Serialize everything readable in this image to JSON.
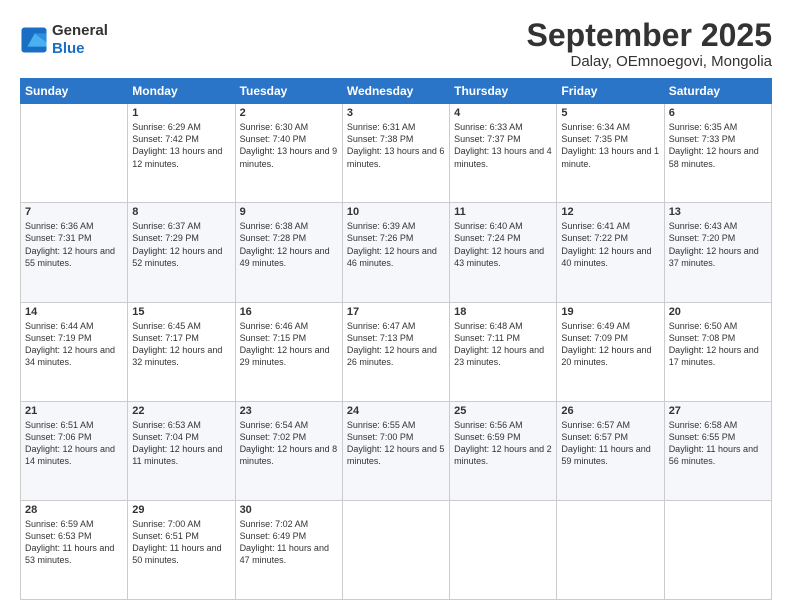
{
  "header": {
    "logo_line1": "General",
    "logo_line2": "Blue",
    "month_title": "September 2025",
    "location": "Dalay, OEmnoegovi, Mongolia"
  },
  "weekdays": [
    "Sunday",
    "Monday",
    "Tuesday",
    "Wednesday",
    "Thursday",
    "Friday",
    "Saturday"
  ],
  "weeks": [
    [
      {
        "day": "",
        "sunrise": "",
        "sunset": "",
        "daylight": ""
      },
      {
        "day": "1",
        "sunrise": "6:29 AM",
        "sunset": "7:42 PM",
        "daylight": "13 hours and 12 minutes."
      },
      {
        "day": "2",
        "sunrise": "6:30 AM",
        "sunset": "7:40 PM",
        "daylight": "13 hours and 9 minutes."
      },
      {
        "day": "3",
        "sunrise": "6:31 AM",
        "sunset": "7:38 PM",
        "daylight": "13 hours and 6 minutes."
      },
      {
        "day": "4",
        "sunrise": "6:33 AM",
        "sunset": "7:37 PM",
        "daylight": "13 hours and 4 minutes."
      },
      {
        "day": "5",
        "sunrise": "6:34 AM",
        "sunset": "7:35 PM",
        "daylight": "13 hours and 1 minute."
      },
      {
        "day": "6",
        "sunrise": "6:35 AM",
        "sunset": "7:33 PM",
        "daylight": "12 hours and 58 minutes."
      }
    ],
    [
      {
        "day": "7",
        "sunrise": "6:36 AM",
        "sunset": "7:31 PM",
        "daylight": "12 hours and 55 minutes."
      },
      {
        "day": "8",
        "sunrise": "6:37 AM",
        "sunset": "7:29 PM",
        "daylight": "12 hours and 52 minutes."
      },
      {
        "day": "9",
        "sunrise": "6:38 AM",
        "sunset": "7:28 PM",
        "daylight": "12 hours and 49 minutes."
      },
      {
        "day": "10",
        "sunrise": "6:39 AM",
        "sunset": "7:26 PM",
        "daylight": "12 hours and 46 minutes."
      },
      {
        "day": "11",
        "sunrise": "6:40 AM",
        "sunset": "7:24 PM",
        "daylight": "12 hours and 43 minutes."
      },
      {
        "day": "12",
        "sunrise": "6:41 AM",
        "sunset": "7:22 PM",
        "daylight": "12 hours and 40 minutes."
      },
      {
        "day": "13",
        "sunrise": "6:43 AM",
        "sunset": "7:20 PM",
        "daylight": "12 hours and 37 minutes."
      }
    ],
    [
      {
        "day": "14",
        "sunrise": "6:44 AM",
        "sunset": "7:19 PM",
        "daylight": "12 hours and 34 minutes."
      },
      {
        "day": "15",
        "sunrise": "6:45 AM",
        "sunset": "7:17 PM",
        "daylight": "12 hours and 32 minutes."
      },
      {
        "day": "16",
        "sunrise": "6:46 AM",
        "sunset": "7:15 PM",
        "daylight": "12 hours and 29 minutes."
      },
      {
        "day": "17",
        "sunrise": "6:47 AM",
        "sunset": "7:13 PM",
        "daylight": "12 hours and 26 minutes."
      },
      {
        "day": "18",
        "sunrise": "6:48 AM",
        "sunset": "7:11 PM",
        "daylight": "12 hours and 23 minutes."
      },
      {
        "day": "19",
        "sunrise": "6:49 AM",
        "sunset": "7:09 PM",
        "daylight": "12 hours and 20 minutes."
      },
      {
        "day": "20",
        "sunrise": "6:50 AM",
        "sunset": "7:08 PM",
        "daylight": "12 hours and 17 minutes."
      }
    ],
    [
      {
        "day": "21",
        "sunrise": "6:51 AM",
        "sunset": "7:06 PM",
        "daylight": "12 hours and 14 minutes."
      },
      {
        "day": "22",
        "sunrise": "6:53 AM",
        "sunset": "7:04 PM",
        "daylight": "12 hours and 11 minutes."
      },
      {
        "day": "23",
        "sunrise": "6:54 AM",
        "sunset": "7:02 PM",
        "daylight": "12 hours and 8 minutes."
      },
      {
        "day": "24",
        "sunrise": "6:55 AM",
        "sunset": "7:00 PM",
        "daylight": "12 hours and 5 minutes."
      },
      {
        "day": "25",
        "sunrise": "6:56 AM",
        "sunset": "6:59 PM",
        "daylight": "12 hours and 2 minutes."
      },
      {
        "day": "26",
        "sunrise": "6:57 AM",
        "sunset": "6:57 PM",
        "daylight": "11 hours and 59 minutes."
      },
      {
        "day": "27",
        "sunrise": "6:58 AM",
        "sunset": "6:55 PM",
        "daylight": "11 hours and 56 minutes."
      }
    ],
    [
      {
        "day": "28",
        "sunrise": "6:59 AM",
        "sunset": "6:53 PM",
        "daylight": "11 hours and 53 minutes."
      },
      {
        "day": "29",
        "sunrise": "7:00 AM",
        "sunset": "6:51 PM",
        "daylight": "11 hours and 50 minutes."
      },
      {
        "day": "30",
        "sunrise": "7:02 AM",
        "sunset": "6:49 PM",
        "daylight": "11 hours and 47 minutes."
      },
      {
        "day": "",
        "sunrise": "",
        "sunset": "",
        "daylight": ""
      },
      {
        "day": "",
        "sunrise": "",
        "sunset": "",
        "daylight": ""
      },
      {
        "day": "",
        "sunrise": "",
        "sunset": "",
        "daylight": ""
      },
      {
        "day": "",
        "sunrise": "",
        "sunset": "",
        "daylight": ""
      }
    ]
  ]
}
